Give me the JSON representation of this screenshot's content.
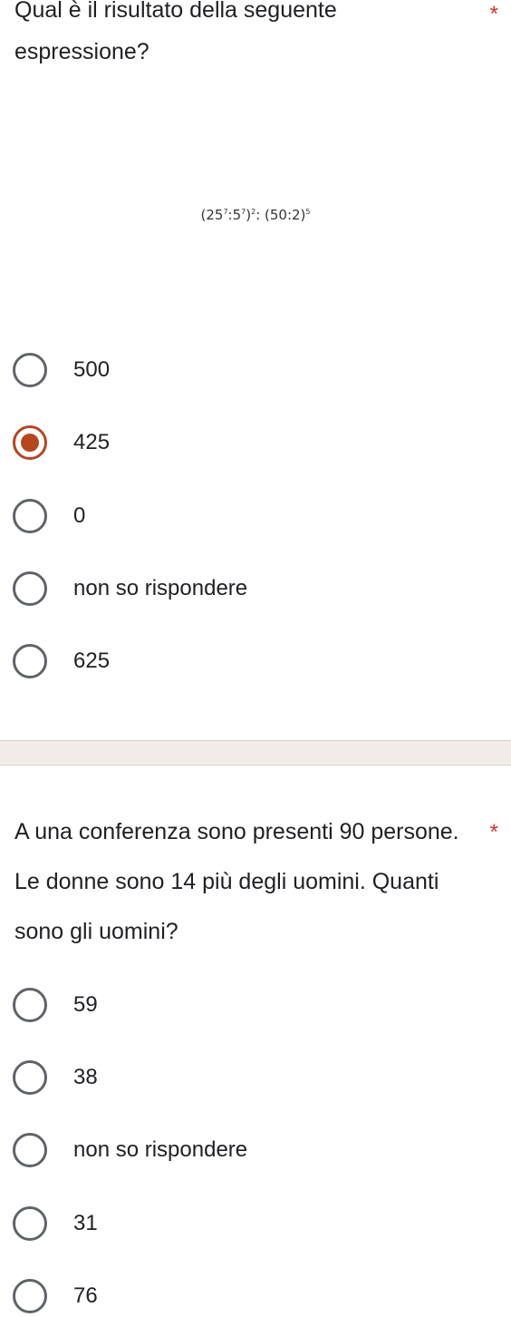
{
  "questions": [
    {
      "title": "Qual è il risultato della seguente espressione?",
      "required_mark": "*",
      "expression": {
        "a": "(25",
        "a_exp": "7",
        "b": ":5",
        "b_exp": "7",
        "c": ")",
        "c_exp": "2",
        "d": ": (50:2)",
        "d_exp": "5"
      },
      "options": [
        {
          "label": "500",
          "selected": false
        },
        {
          "label": "425",
          "selected": true
        },
        {
          "label": "0",
          "selected": false
        },
        {
          "label": "non so rispondere",
          "selected": false
        },
        {
          "label": "625",
          "selected": false
        }
      ]
    },
    {
      "title": "A una conferenza sono presenti 90 persone. Le donne sono 14 più degli uomini. Quanti sono gli uomini?",
      "required_mark": "*",
      "options": [
        {
          "label": "59",
          "selected": false
        },
        {
          "label": "38",
          "selected": false
        },
        {
          "label": "non so rispondere",
          "selected": false
        },
        {
          "label": "31",
          "selected": false
        },
        {
          "label": "76",
          "selected": false
        }
      ]
    }
  ],
  "colors": {
    "accent": "#b5461e",
    "radio_border": "#5f6368",
    "required": "#d93025",
    "separator": "#f3ebe7"
  }
}
